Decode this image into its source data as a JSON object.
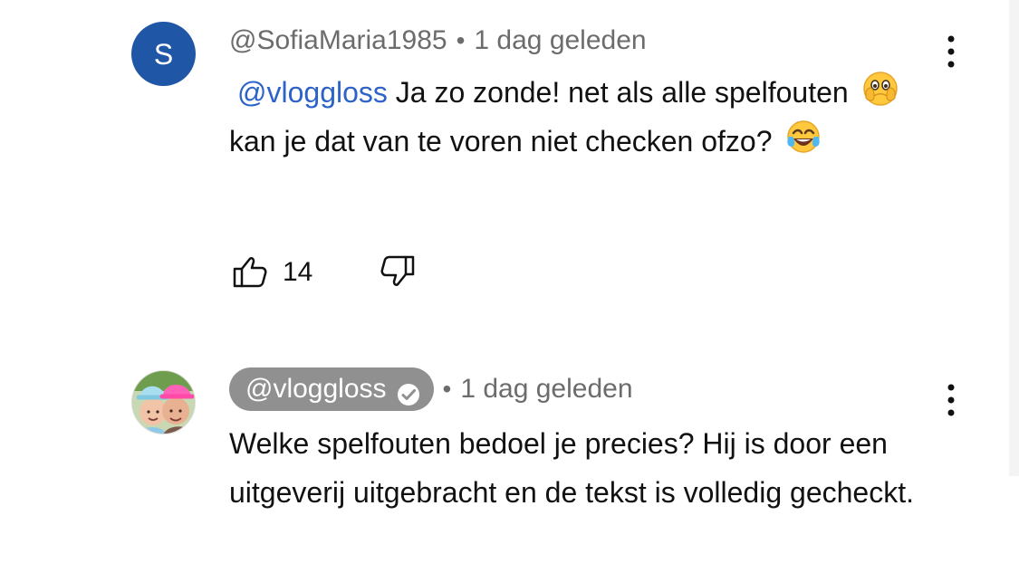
{
  "comments": [
    {
      "avatar_initial": "S",
      "author": "@SofiaMaria1985",
      "separator": "•",
      "time": "1 dag geleden",
      "mention": "@vloggloss",
      "text_part1": "Ja zo zonde! net als alle spelfouten",
      "emoji_1": "face-with-open-eyes-and-hand-over-mouth",
      "text_part2": "kan je dat van te voren niet checken ofzo?",
      "emoji_2": "face-with-tears-of-joy",
      "like_count": "14",
      "icons": {
        "like": "thumbs-up-icon",
        "dislike": "thumbs-down-icon",
        "more": "more-vertical-icon"
      }
    },
    {
      "author": "@vloggloss",
      "separator": "•",
      "time": "1 dag geleden",
      "text": "Welke spelfouten bedoel je precies? Hij is door een uitgeverij uitgebracht en de tekst is volledig gecheckt.",
      "verified_icon": "verified-check-icon",
      "icons": {
        "more": "more-vertical-icon"
      }
    }
  ],
  "colors": {
    "avatar_blue": "#1f56a6",
    "mention_blue": "#2d63c8",
    "secondary_text": "#6c6c6c",
    "channel_pill": "#909090"
  }
}
